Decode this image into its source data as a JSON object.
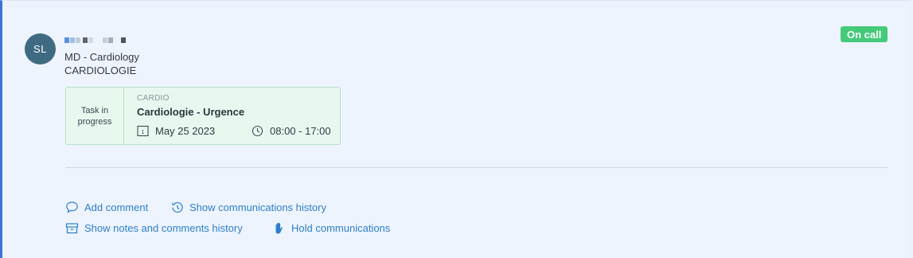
{
  "person": {
    "initials": "SL",
    "role": "MD - Cardiology",
    "department": "CARDIOLOGIE"
  },
  "status": {
    "label": "On call",
    "color": "#45c97a"
  },
  "task": {
    "state_label": "Task in progress",
    "code": "CARDIO",
    "title": "Cardiologie - Urgence",
    "date": "May 25 2023",
    "time": "08:00 - 17:00",
    "date_icon": "calendar-icon",
    "time_icon": "clock-icon"
  },
  "actions": {
    "add_comment": "Add comment",
    "show_comm_history": "Show communications history",
    "show_notes_history": "Show notes and comments history",
    "hold_comm": "Hold communications"
  },
  "colors": {
    "accent": "#3b73d6",
    "link": "#2f7fc8",
    "avatar": "#3e6a82"
  }
}
